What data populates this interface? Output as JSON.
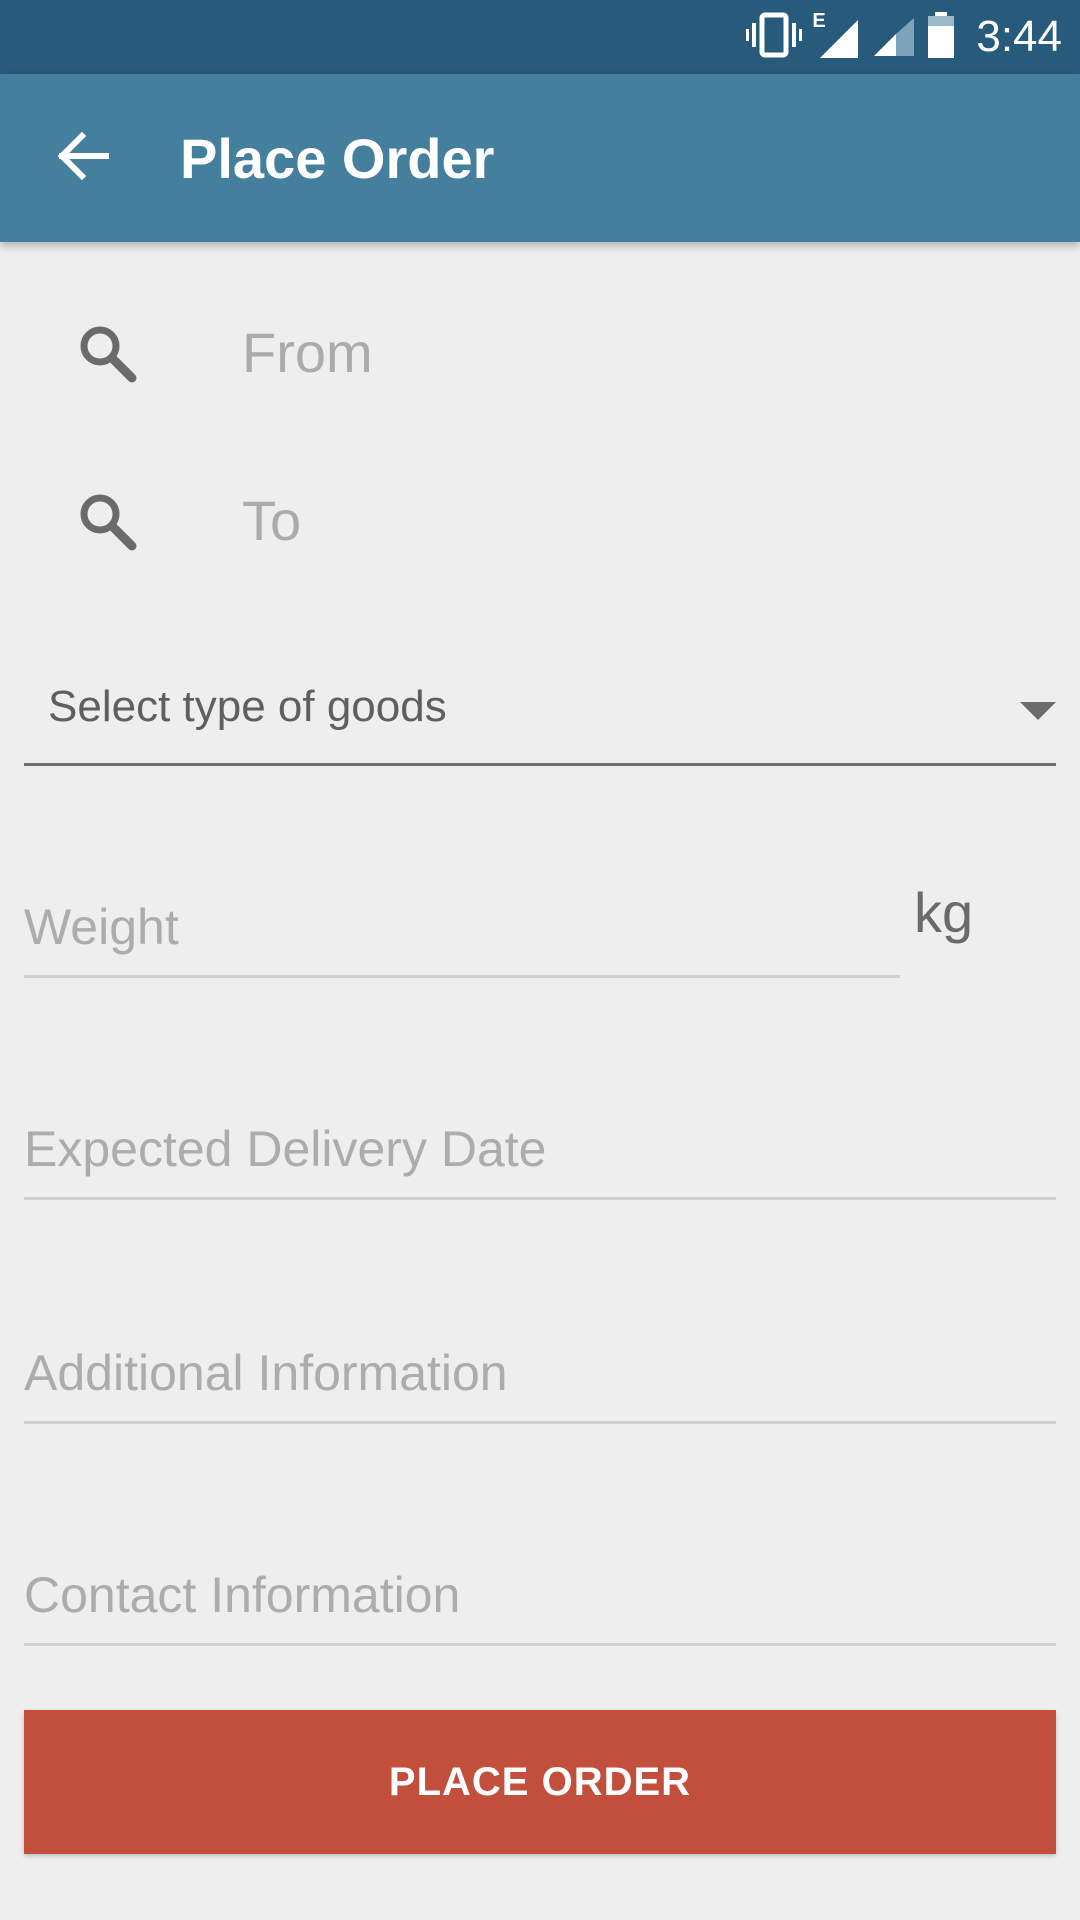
{
  "status_bar": {
    "time": "3:44",
    "network_type": "E",
    "icons": [
      "vibrate-icon",
      "signal-icon",
      "signal-icon",
      "battery-icon"
    ]
  },
  "app_bar": {
    "back_icon": "arrow-back-icon",
    "title": "Place Order"
  },
  "search": {
    "from_placeholder": "From",
    "to_placeholder": "To",
    "icon": "search-icon"
  },
  "goods_select": {
    "label": "Select type of goods",
    "icon": "dropdown-arrow-icon"
  },
  "weight": {
    "placeholder": "Weight",
    "unit": "kg"
  },
  "delivery_date": {
    "placeholder": "Expected Delivery Date"
  },
  "additional_info": {
    "placeholder": "Additional Information"
  },
  "contact_info": {
    "placeholder": "Contact Information"
  },
  "actions": {
    "place_order_label": "PLACE ORDER"
  },
  "colors": {
    "status_bar": "#285a7b",
    "app_bar": "#457f9e",
    "button": "#c24e3c",
    "background": "#eeeeee"
  }
}
